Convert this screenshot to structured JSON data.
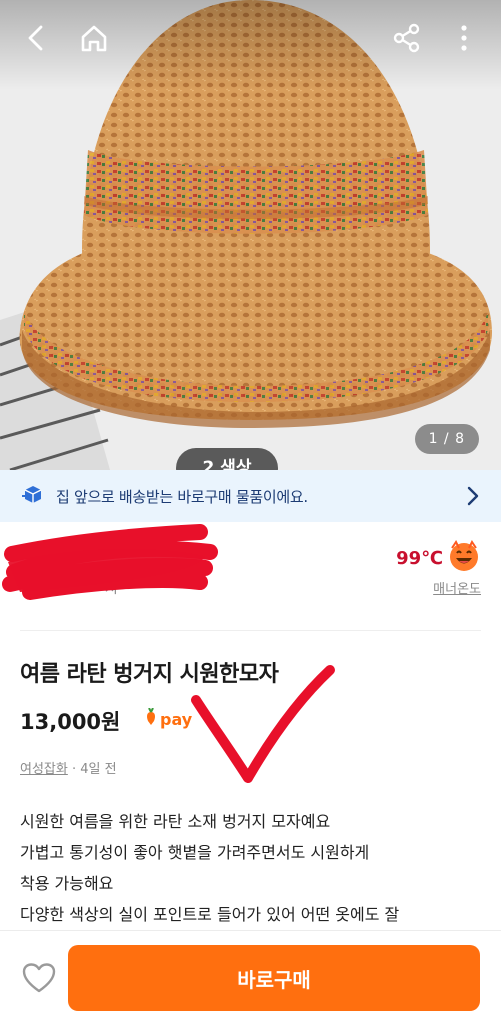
{
  "hero": {
    "counter": "1 / 8",
    "badge_text": "2 색상"
  },
  "top_bar": {
    "icons": [
      "back-arrow-icon",
      "home-icon",
      "share-icon",
      "more-vertical-icon"
    ]
  },
  "banner": {
    "text": "집 앞으로 배송받는 바로구매 물품이에요.",
    "icon": "delivery-box-icon"
  },
  "seller": {
    "location_partial": "ᄅ ᄀ ᄄ ᄀ지ᄉ",
    "temperature": "99℃",
    "manner_label": "매너온도"
  },
  "product": {
    "title": "여름 라탄 벙거지 시원한모자",
    "price": "13,000원",
    "pay_label": "pay",
    "category": "여성잡화",
    "time": " · 4일 전",
    "description": [
      "시원한 여름을 위한 라탄 소재 벙거지 모자예요",
      "가볍고 통기성이 좋아 햇볕을 가려주면서도 시원하게",
      "착용 가능해요",
      "다양한 색상의 실이 포인트로 들어가 있어 어떤 옷에도 잘"
    ]
  },
  "bottom": {
    "buy_label": "바로구매"
  },
  "colors": {
    "accent": "#ff6f0f",
    "temperature": "#c8102e",
    "banner_bg": "#eaf4fd",
    "banner_text": "#1d3c74",
    "hat": "#d9a061"
  }
}
